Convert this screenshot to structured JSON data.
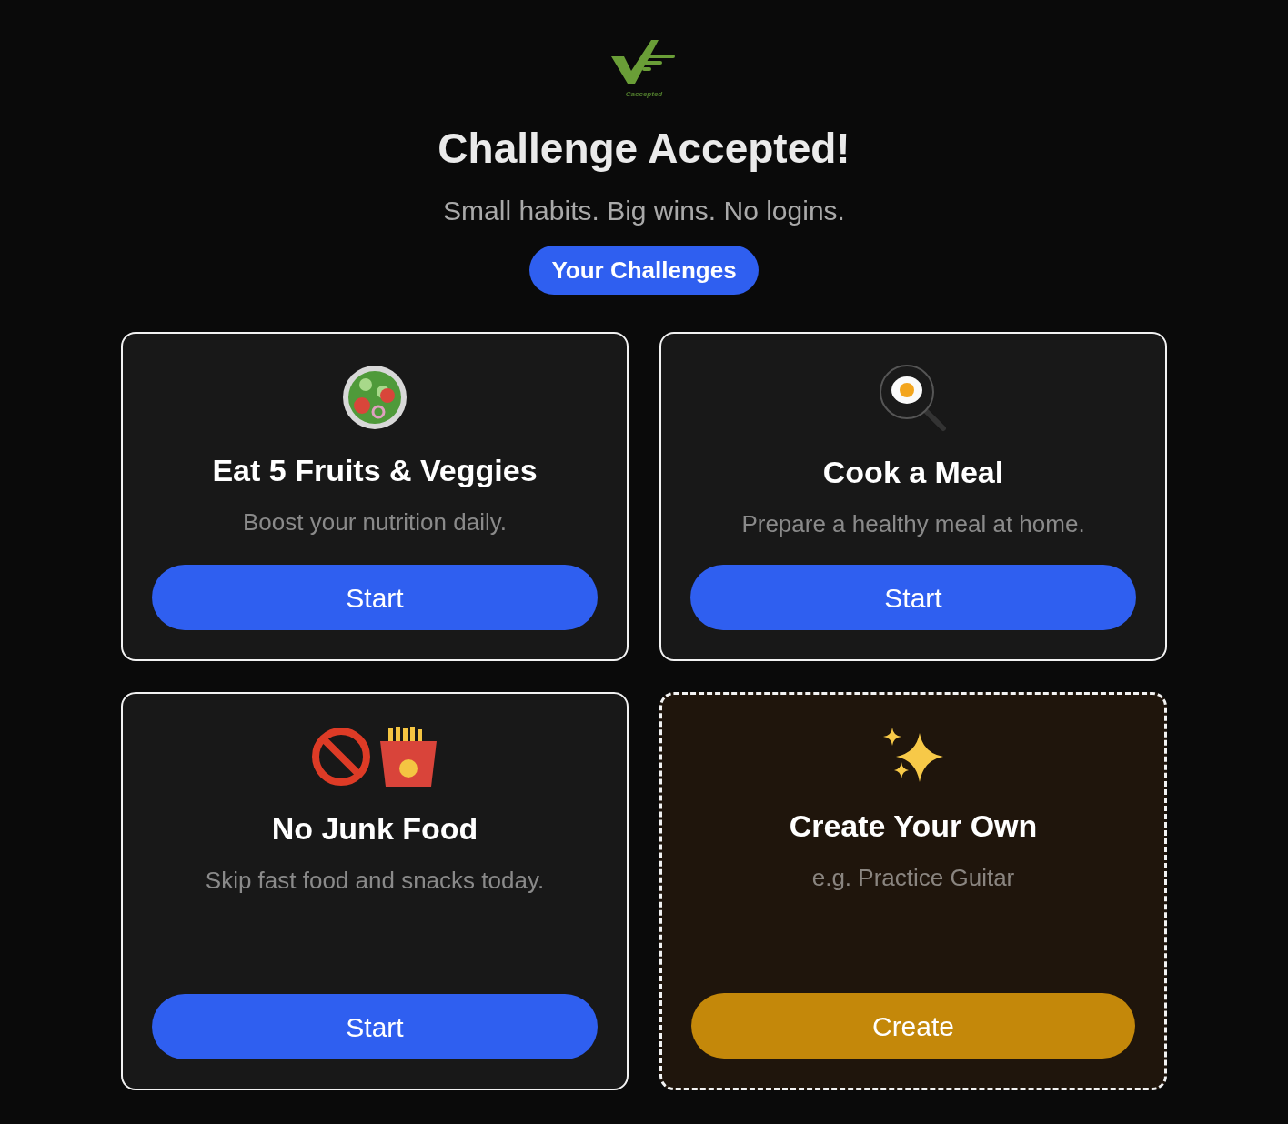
{
  "logo": {
    "caption": "Caccepted"
  },
  "title": "Challenge Accepted!",
  "subtitle": "Small habits. Big wins. No logins.",
  "nav_button": "Your Challenges",
  "cards": [
    {
      "kind": "challenge",
      "title": "Eat 5 Fruits & Veggies",
      "description": "Boost your nutrition daily.",
      "button": "Start"
    },
    {
      "kind": "challenge",
      "title": "Cook a Meal",
      "description": "Prepare a healthy meal at home.",
      "button": "Start"
    },
    {
      "kind": "challenge",
      "title": "No Junk Food",
      "description": "Skip fast food and snacks today.",
      "button": "Start"
    },
    {
      "kind": "custom",
      "title": "Create Your Own",
      "description": "e.g. Practice Guitar",
      "button": "Create"
    }
  ]
}
